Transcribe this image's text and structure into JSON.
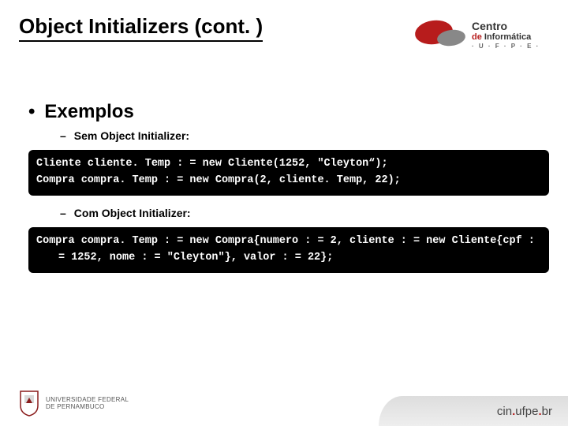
{
  "slide": {
    "title": "Object Initializers (cont. )",
    "logo_cin": {
      "line1": "Centro",
      "line2_de": "de",
      "line2_rest": "Informática",
      "line3": "· U · F · P · E ·"
    },
    "bullets": {
      "examples": "Exemplos",
      "without": "Sem Object Initializer:",
      "with": "Com Object Initializer:"
    },
    "code1": {
      "line1": "Cliente cliente. Temp : = new Cliente(1252, \"Cleyton“);",
      "line2": "Compra compra. Temp : = new Compra(2, cliente. Temp, 22);"
    },
    "code2": {
      "text": "Compra compra. Temp : = new Compra{numero : = 2, cliente : = new Cliente{cpf : = 1252, nome : = \"Cleyton\"}, valor : = 22};"
    },
    "footer": {
      "ufpe_line1": "UNIVERSIDADE FEDERAL",
      "ufpe_line2": "DE PERNAMBUCO",
      "url_pre": "cin",
      "url_dot": ".",
      "url_mid": "ufpe",
      "url_post": "br"
    }
  }
}
